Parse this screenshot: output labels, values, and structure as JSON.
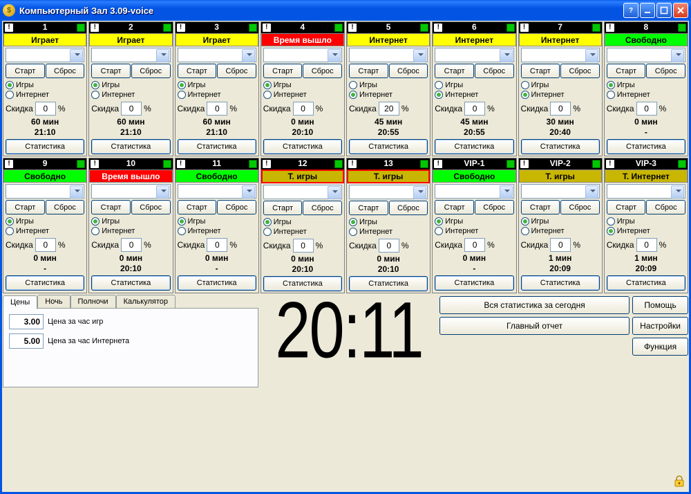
{
  "window": {
    "title": "Компьютерный Зал 3.09-voice"
  },
  "labels": {
    "start": "Старт",
    "reset": "Сброс",
    "games": "Игры",
    "internet": "Интернет",
    "discount": "Скидка",
    "percent": "%",
    "statistics": "Статистика"
  },
  "cells": [
    {
      "id": "1",
      "status": "Играет",
      "statusClass": "status-yellow",
      "mode": "games",
      "discount": "0",
      "mins": "60 мин",
      "end": "21:10"
    },
    {
      "id": "2",
      "status": "Играет",
      "statusClass": "status-yellow",
      "mode": "games",
      "discount": "0",
      "mins": "60 мин",
      "end": "21:10"
    },
    {
      "id": "3",
      "status": "Играет",
      "statusClass": "status-yellow",
      "mode": "games",
      "discount": "0",
      "mins": "60 мин",
      "end": "21:10"
    },
    {
      "id": "4",
      "status": "Время вышло",
      "statusClass": "status-red",
      "mode": "games",
      "discount": "0",
      "mins": "0 мин",
      "end": "20:10"
    },
    {
      "id": "5",
      "status": "Интернет",
      "statusClass": "status-yellow",
      "mode": "internet",
      "discount": "20",
      "mins": "45 мин",
      "end": "20:55"
    },
    {
      "id": "6",
      "status": "Интернет",
      "statusClass": "status-yellow",
      "mode": "internet",
      "discount": "0",
      "mins": "45 мин",
      "end": "20:55"
    },
    {
      "id": "7",
      "status": "Интернет",
      "statusClass": "status-yellow",
      "mode": "internet",
      "discount": "0",
      "mins": "30 мин",
      "end": "20:40"
    },
    {
      "id": "8",
      "status": "Свободно",
      "statusClass": "status-green",
      "mode": "games",
      "discount": "0",
      "mins": "0 мин",
      "end": "-"
    },
    {
      "id": "9",
      "status": "Свободно",
      "statusClass": "status-green",
      "mode": "games",
      "discount": "0",
      "mins": "0 мин",
      "end": "-"
    },
    {
      "id": "10",
      "status": "Время вышло",
      "statusClass": "status-red",
      "mode": "games",
      "discount": "0",
      "mins": "0 мин",
      "end": "20:10"
    },
    {
      "id": "11",
      "status": "Свободно",
      "statusClass": "status-green",
      "mode": "games",
      "discount": "0",
      "mins": "0 мин",
      "end": "-"
    },
    {
      "id": "12",
      "status": "Т. игры",
      "statusClass": "status-olive",
      "mode": "games",
      "discount": "0",
      "mins": "0 мин",
      "end": "20:10"
    },
    {
      "id": "13",
      "status": "Т. игры",
      "statusClass": "status-olive",
      "mode": "games",
      "discount": "0",
      "mins": "0 мин",
      "end": "20:10"
    },
    {
      "id": "VIP-1",
      "status": "Свободно",
      "statusClass": "status-green",
      "mode": "games",
      "discount": "0",
      "mins": "0 мин",
      "end": "-"
    },
    {
      "id": "VIP-2",
      "status": "Т. игры",
      "statusClass": "status-olive-noborder",
      "mode": "games",
      "discount": "0",
      "mins": "1 мин",
      "end": "20:09"
    },
    {
      "id": "VIP-3",
      "status": "Т. Интернет",
      "statusClass": "status-olive-noborder",
      "mode": "internet",
      "discount": "0",
      "mins": "1 мин",
      "end": "20:09"
    }
  ],
  "tabs": {
    "items": [
      "Цены",
      "Ночь",
      "Полночи",
      "Калькулятор"
    ],
    "active": 0,
    "price_games": "3.00",
    "price_games_label": "Цена за час игр",
    "price_internet": "5.00",
    "price_internet_label": "Цена за час Интернета"
  },
  "clock": "20:11",
  "buttons": {
    "all_stats": "Вся статистика за сегодня",
    "main_report": "Главный отчет",
    "help": "Помощь",
    "settings": "Настройки",
    "function": "Функция"
  }
}
